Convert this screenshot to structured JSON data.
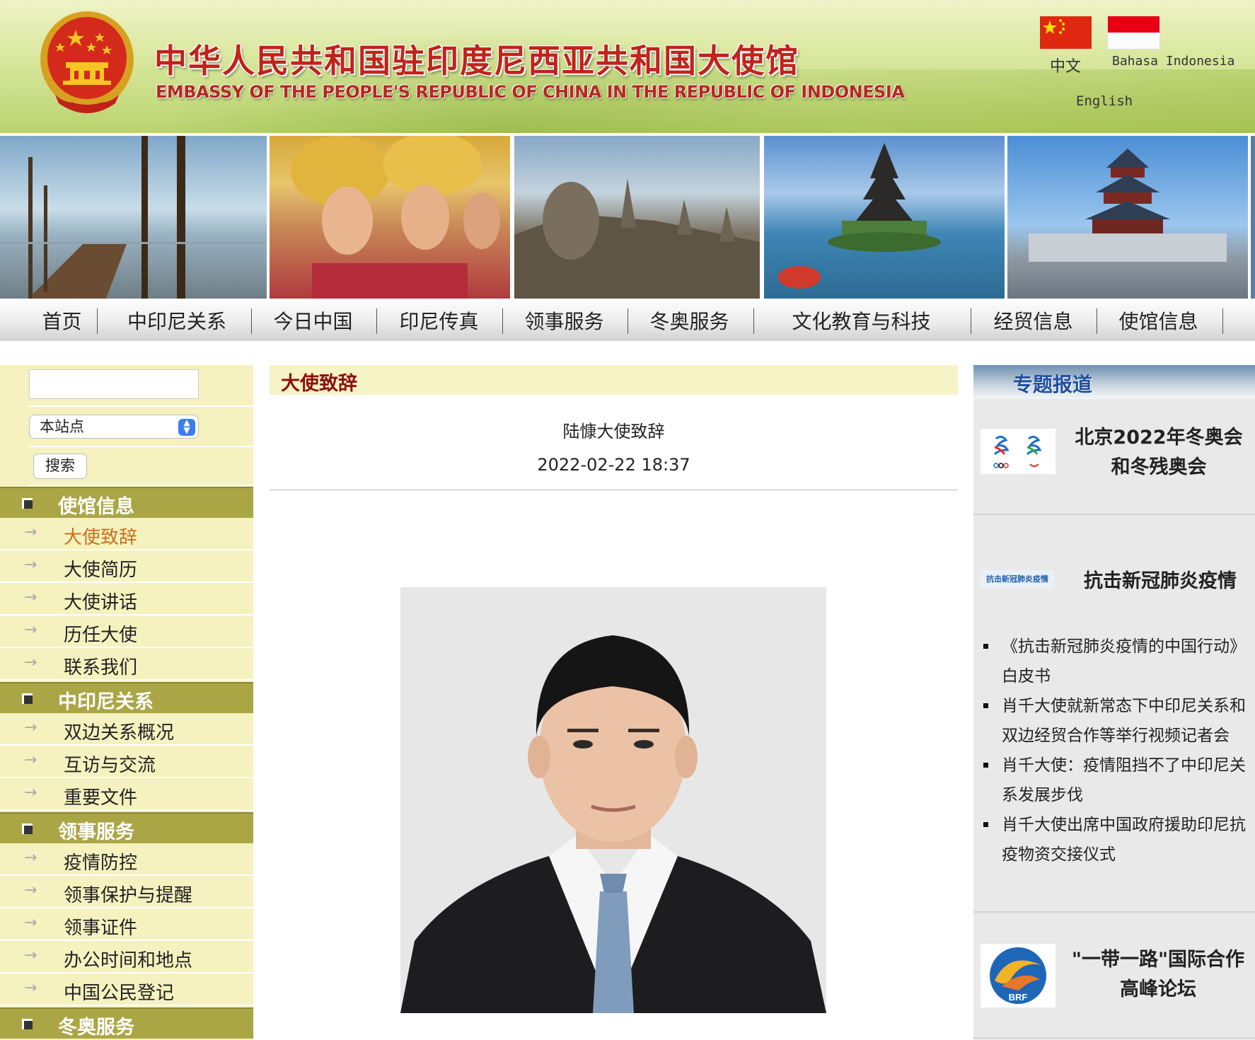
{
  "header": {
    "title_cn": "中华人民共和国驻印度尼西亚共和国大使馆",
    "title_en": "EMBASSY OF THE PEOPLE'S REPUBLIC OF CHINA IN THE REPUBLIC OF INDONESIA",
    "languages": {
      "zh": "中文",
      "id": "Bahasa Indonesia",
      "en": "English"
    },
    "colors": {
      "title_red": "#c0231a",
      "flag_cn": "#de2910",
      "flag_id_red": "#e70011"
    }
  },
  "nav": [
    {
      "label": "首页"
    },
    {
      "label": "中印尼关系"
    },
    {
      "label": "今日中国"
    },
    {
      "label": "印尼传真"
    },
    {
      "label": "领事服务"
    },
    {
      "label": "冬奥服务"
    },
    {
      "label": "文化教育与科技"
    },
    {
      "label": "经贸信息"
    },
    {
      "label": "使馆信息"
    }
  ],
  "search": {
    "input_value": "",
    "scope_selected": "本站点",
    "button_label": "搜索"
  },
  "sidebar": {
    "sections": [
      {
        "title": "使馆信息",
        "items": [
          "大使致辞",
          "大使简历",
          "大使讲话",
          "历任大使",
          "联系我们"
        ],
        "active": "大使致辞"
      },
      {
        "title": "中印尼关系",
        "items": [
          "双边关系概况",
          "互访与交流",
          "重要文件"
        ]
      },
      {
        "title": "领事服务",
        "items": [
          "疫情防控",
          "领事保护与提醒",
          "领事证件",
          "办公时间和地点",
          "中国公民登记"
        ]
      },
      {
        "title": "冬奥服务",
        "items": []
      }
    ],
    "colors": {
      "section_bg": "#aba645",
      "panel_bg": "#f5f2c0",
      "active_text": "#c8701c"
    }
  },
  "main": {
    "section_title": "大使致辞",
    "article_title": "陆慷大使致辞",
    "article_date": "2022-02-22 18:37"
  },
  "right": {
    "header_title": "专题报道",
    "cards": [
      {
        "title_line1": "北京2022年冬奥会",
        "title_line2": "和冬残奥会"
      },
      {
        "icon_text": "抗击新冠肺炎疫情",
        "title": "抗击新冠肺炎疫情"
      },
      {
        "title_line1": "\"一带一路\"国际合作",
        "title_line2": "高峰论坛",
        "icon_text": "BRF"
      }
    ],
    "news": [
      "《抗击新冠肺炎疫情的中国行动》白皮书",
      "肖千大使就新常态下中印尼关系和双边经贸合作等举行视频记者会",
      "肖千大使：疫情阻挡不了中印尼关系发展步伐",
      "肖千大使出席中国政府援助印尼抗疫物资交接仪式"
    ]
  }
}
